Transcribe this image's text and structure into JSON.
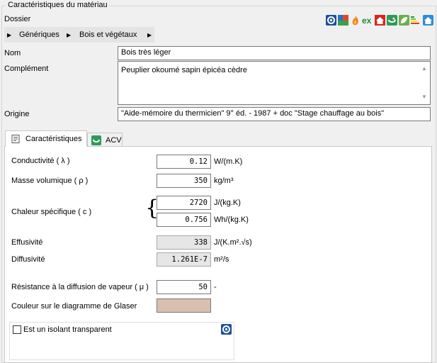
{
  "window": {
    "group_title": "Caractéristiques du matériau"
  },
  "dossier": {
    "label": "Dossier",
    "breadcrumb": [
      "Génériques",
      "Bois et végétaux"
    ]
  },
  "toolbar": {
    "icons": [
      "help-gear-icon",
      "rainbow-icon",
      "fire-icon",
      "excel-icon",
      "house-red-icon",
      "plant-icon",
      "leaf-icon",
      "energy-label-icon",
      "home-icon"
    ],
    "ex_text": "ex"
  },
  "fields": {
    "nom_label": "Nom",
    "nom_value": "Bois très léger",
    "complement_label": "Complément",
    "complement_value": "Peuplier okoumé sapin épicéa cèdre",
    "origine_label": "Origine",
    "origine_value": "\"Aide-mémoire du thermicien\" 9° éd. - 1987 + doc \"Stage chauffage au bois\""
  },
  "tabs": [
    {
      "label": "Caractéristiques",
      "active": true
    },
    {
      "label": "ACV",
      "active": false
    }
  ],
  "properties": {
    "conductivite": {
      "label": "Conductivité ( λ )",
      "value": "0.12",
      "unit": "W/(m.K)"
    },
    "masse": {
      "label": "Masse volumique ( ρ )",
      "value": "350",
      "unit": "kg/m³"
    },
    "chaleur": {
      "label": "Chaleur spécifique ( c )",
      "value1": "2720",
      "unit1": "J/(kg.K)",
      "value2": "0.756",
      "unit2": "Wh/(kg.K)",
      "brace": "{"
    },
    "effusivite": {
      "label": "Effusivité",
      "value": "338",
      "unit": "J/(K.m².√s)"
    },
    "diffusivite": {
      "label": "Diffusivité",
      "value": "1.261E-7",
      "unit": "m²/s"
    },
    "resistance": {
      "label": "Résistance à la diffusion de vapeur ( μ )",
      "value": "50",
      "unit": "-"
    },
    "couleur": {
      "label": "Couleur sur le diagramme de Glaser",
      "color": "#d8bfb0"
    },
    "isolant": {
      "label": "Est un isolant transparent",
      "checked": false
    }
  },
  "scroll": {
    "up": "▲",
    "down": "▼"
  },
  "breadcrumb_arrow": "▶"
}
